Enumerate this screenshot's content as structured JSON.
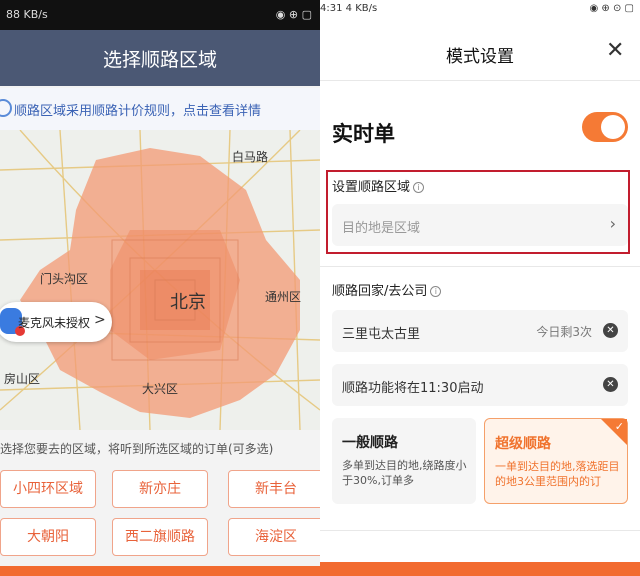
{
  "left": {
    "status_bar": {
      "left": "88 KB/s",
      "right": "◉ ⊕ ▢"
    },
    "title": "选择顺路区域",
    "notice": "顺路区域采用顺路计价规则，点击查看详情",
    "map": {
      "center_label": "北京",
      "districts": [
        "白马路",
        "门头沟区",
        "通州区",
        "房山区",
        "大兴区"
      ],
      "mic_prompt": "麦克风未授权",
      "mic_chevron": ">"
    },
    "hint": "选择您要去的区域，将听到所选区域的订单(可多选)",
    "chips": [
      "小四环区域",
      "新亦庄",
      "新丰台",
      "大朝阳",
      "西二旗顺路",
      "海淀区"
    ],
    "colors": {
      "header_bg": "#4b5874",
      "heat": "#f39a74",
      "accent": "#e8623a"
    }
  },
  "right": {
    "status_bar": {
      "left": "4:31",
      "signal": "4 KB/s",
      "right": "◉ ⊕ ⊙ ▢"
    },
    "title": "模式设置",
    "close_icon": "close-icon",
    "realtime_label": "实时单",
    "realtime_on": true,
    "zone_section": {
      "label": "设置顺路区域",
      "field_placeholder": "目的地是区域"
    },
    "home_section": {
      "label": "顺路回家/去公司",
      "row1_text": "三里屯太古里",
      "row1_count": "今日剩3次",
      "row2_text": "顺路功能将在11:30启动"
    },
    "cards": [
      {
        "title": "一般顺路",
        "desc": "多单到达目的地,绕路度小于30%,订单多",
        "selected": false
      },
      {
        "title": "超级顺路",
        "desc": "一单到达目的地,落选距目的地3公里范围内的订",
        "selected": true
      }
    ],
    "colors": {
      "accent": "#f57a35",
      "highlight_border": "#c21d2e"
    }
  }
}
